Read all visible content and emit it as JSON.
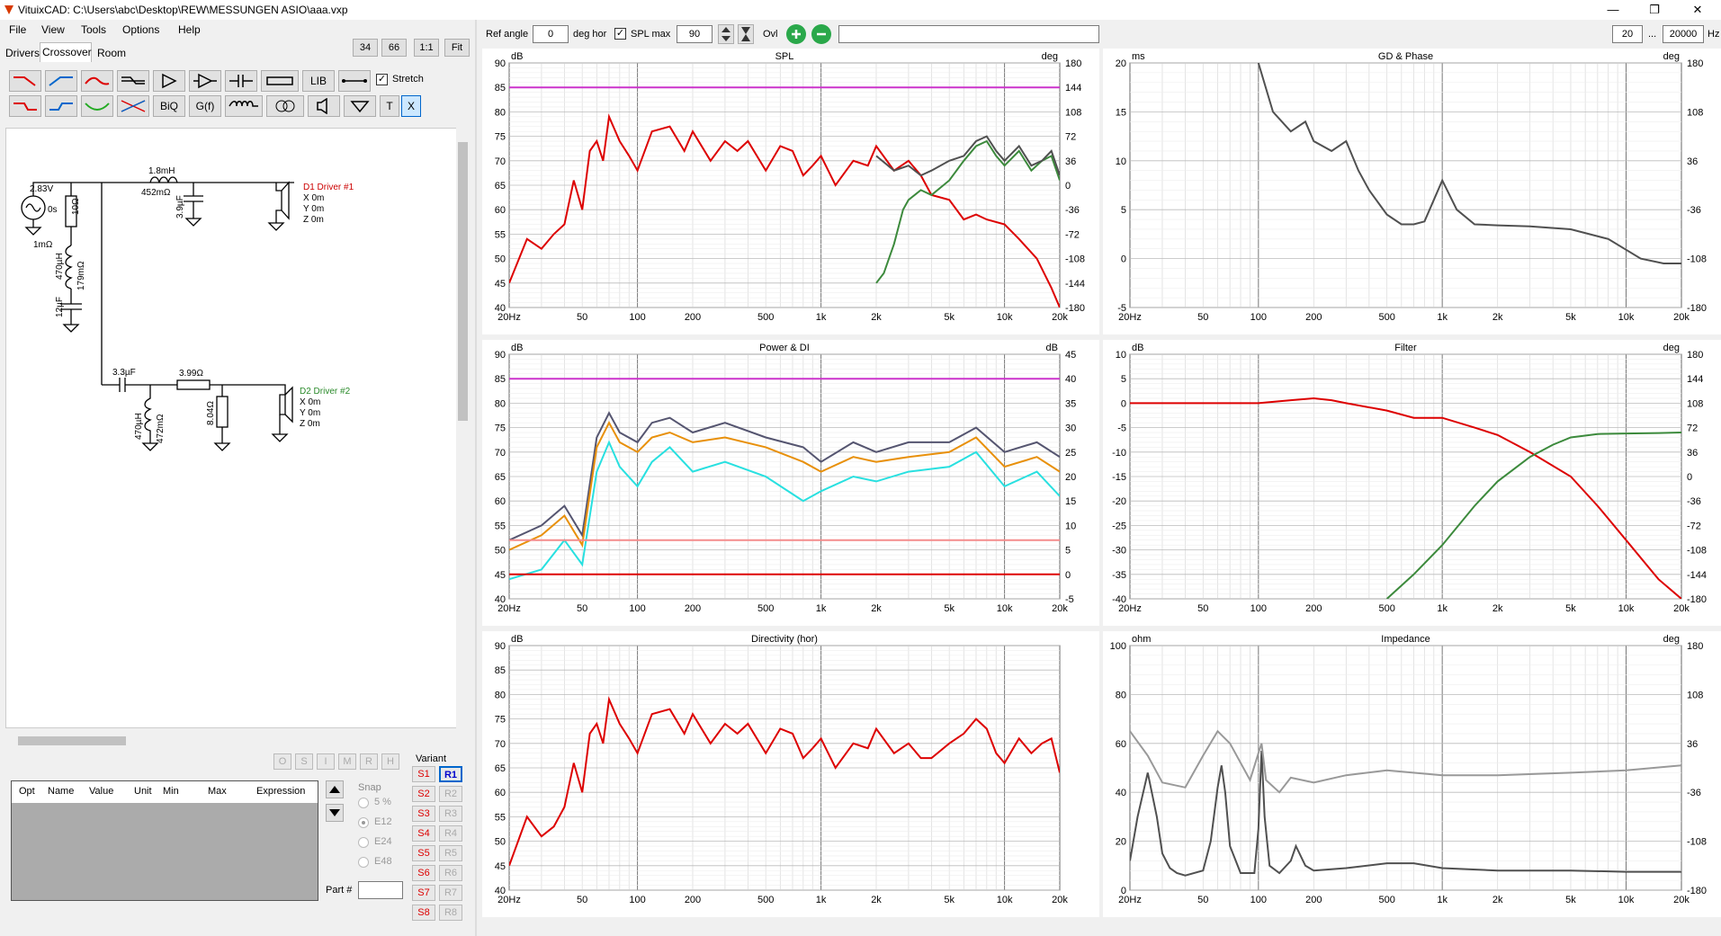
{
  "title": "VituixCAD: C:\\Users\\abc\\Desktop\\REW\\MESSUNGEN ASIO\\aaa.vxp",
  "menu": [
    "File",
    "View",
    "Tools",
    "Options",
    "Help"
  ],
  "tabs": [
    "Drivers",
    "Crossover",
    "Room"
  ],
  "zoom_buttons": [
    "34",
    "66",
    "1:1",
    "Fit"
  ],
  "toolbar": {
    "lib": "LIB",
    "stretch": "Stretch",
    "biq": "BiQ",
    "gf": "G(f)",
    "t": "T",
    "x": "X"
  },
  "top_controls": {
    "ref_angle_label": "Ref angle",
    "ref_angle_value": "0",
    "deg_hor": "deg hor",
    "splmax_label": "SPL max",
    "splmax_value": "90",
    "ovl": "Ovl",
    "freq_from": "20",
    "freq_sep": "...",
    "freq_to": "20000",
    "freq_unit": "Hz"
  },
  "schematic": {
    "source_v": "2.83V",
    "source_ang": "0s",
    "source_r": "1mΩ",
    "r1": "10Ω",
    "l_series": "1.8mH",
    "l_series_r": "452mΩ",
    "c_shunt": "3.9µF",
    "d1_name": "D1 Driver #1",
    "d1_x": "X 0m",
    "d1_y": "Y 0m",
    "d1_z": "Z 0m",
    "l_notch": "470µH",
    "l_notch_r": "179mΩ",
    "c_notch": "12µF",
    "c2": "3.3µF",
    "r2": "3.99Ω",
    "l2": "470µH",
    "l2_r": "472mΩ",
    "r3": "8.04Ω",
    "d2_name": "D2 Driver #2",
    "d2_x": "X 0m",
    "d2_y": "Y 0m",
    "d2_z": "Z 0m"
  },
  "param_table": {
    "headers": [
      "Opt",
      "Name",
      "Value",
      "Unit",
      "Min",
      "Max",
      "Expression"
    ]
  },
  "oslmrh": [
    "O",
    "S",
    "I",
    "M",
    "R",
    "H"
  ],
  "snap": {
    "label": "Snap",
    "options": [
      "5 %",
      "E12",
      "E24",
      "E48"
    ],
    "selected": "E12"
  },
  "part_label": "Part #",
  "variant": {
    "label": "Variant",
    "s": [
      "S1",
      "S2",
      "S3",
      "S4",
      "S5",
      "S6",
      "S7",
      "S8"
    ],
    "r": [
      "R1",
      "R2",
      "R3",
      "R4",
      "R5",
      "R6",
      "R7",
      "R8"
    ]
  },
  "colors": {
    "red": "#dd0000",
    "green": "#3c8a3c",
    "darkgrey": "#505050",
    "orange": "#e8900a",
    "cyan": "#28e0e0",
    "navy": "#555570",
    "magenta": "#cc33cc",
    "pink": "#f48c8c"
  },
  "chart_data": [
    {
      "type": "line",
      "title": "SPL",
      "ylabel": "dB",
      "y2label": "deg",
      "ylim": [
        40,
        90
      ],
      "y2lim": [
        -180,
        180
      ],
      "xscale": "log",
      "xlim": [
        20,
        20000
      ],
      "yticks": [
        "90",
        "85",
        "80",
        "75",
        "70",
        "65",
        "60",
        "55",
        "50",
        "45",
        "40"
      ],
      "y2ticks": [
        "180",
        "144",
        "108",
        "72",
        "36",
        "0",
        "-36",
        "-72",
        "-108",
        "-144",
        "-180"
      ],
      "xticks": [
        "20Hz",
        "50",
        "100",
        "200",
        "500",
        "1k",
        "2k",
        "5k",
        "10k",
        "20k"
      ],
      "series": [
        {
          "color": "#dd0000",
          "x": [
            20,
            25,
            30,
            35,
            40,
            45,
            50,
            55,
            60,
            65,
            70,
            80,
            90,
            100,
            120,
            150,
            180,
            200,
            250,
            300,
            350,
            400,
            500,
            600,
            700,
            800,
            900,
            1000,
            1200,
            1500,
            1800,
            2000,
            2500,
            3000,
            3500,
            4000,
            5000,
            6000,
            7000,
            8000,
            10000,
            12000,
            15000,
            18000,
            20000
          ],
          "y": [
            45,
            54,
            52,
            55,
            57,
            66,
            60,
            72,
            74,
            70,
            79,
            74,
            71,
            68,
            76,
            77,
            72,
            76,
            70,
            74,
            72,
            74,
            68,
            73,
            72,
            67,
            69,
            71,
            65,
            70,
            69,
            73,
            68,
            70,
            67,
            63,
            62,
            58,
            59,
            58,
            57,
            54,
            50,
            44,
            40
          ]
        },
        {
          "color": "#3c8a3c",
          "x": [
            2000,
            2200,
            2500,
            2800,
            3000,
            3500,
            4000,
            5000,
            6000,
            7000,
            8000,
            9000,
            10000,
            12000,
            14000,
            16000,
            18000,
            20000
          ],
          "y": [
            45,
            47,
            53,
            60,
            62,
            64,
            63,
            66,
            70,
            73,
            74,
            71,
            69,
            72,
            68,
            70,
            71,
            66
          ]
        },
        {
          "color": "#505050",
          "x": [
            2000,
            2500,
            3000,
            3500,
            4000,
            5000,
            6000,
            7000,
            8000,
            9000,
            10000,
            12000,
            14000,
            16000,
            18000,
            20000
          ],
          "y": [
            71,
            68,
            69,
            67,
            68,
            70,
            71,
            74,
            75,
            72,
            70,
            73,
            69,
            70,
            72,
            67
          ]
        },
        {
          "color": "#cc33cc",
          "x": [
            20,
            20000
          ],
          "y": [
            85,
            85
          ]
        }
      ]
    },
    {
      "type": "line",
      "title": "GD & Phase",
      "ylabel": "ms",
      "y2label": "deg",
      "ylim": [
        -5,
        20
      ],
      "y2lim": [
        -180,
        180
      ],
      "xscale": "log",
      "xlim": [
        20,
        20000
      ],
      "yticks": [
        "20",
        "15",
        "10",
        "5",
        "0",
        "-5"
      ],
      "y2ticks": [
        "180",
        "108",
        "36",
        "-36",
        "-108",
        "-180"
      ],
      "xticks": [
        "20Hz",
        "50",
        "100",
        "200",
        "500",
        "1k",
        "2k",
        "5k",
        "10k",
        "20k"
      ],
      "series": [
        {
          "color": "#505050",
          "x": [
            100,
            120,
            150,
            180,
            200,
            250,
            300,
            350,
            400,
            500,
            600,
            700,
            800,
            900,
            1000,
            1200,
            1500,
            2000,
            3000,
            5000,
            8000,
            12000,
            16000,
            20000
          ],
          "y": [
            20,
            15,
            13,
            14,
            12,
            11,
            12,
            9,
            7,
            4.5,
            3.5,
            3.5,
            3.8,
            6,
            8,
            5,
            3.5,
            3.4,
            3.3,
            3,
            2,
            0,
            -0.5,
            -0.5
          ]
        }
      ]
    },
    {
      "type": "line",
      "title": "Power & DI",
      "ylabel": "dB",
      "y2label": "dB",
      "ylim": [
        40,
        90
      ],
      "y2lim": [
        -5,
        45
      ],
      "xscale": "log",
      "xlim": [
        20,
        20000
      ],
      "yticks": [
        "90",
        "85",
        "80",
        "75",
        "70",
        "65",
        "60",
        "55",
        "50",
        "45",
        "40"
      ],
      "y2ticks": [
        "45",
        "40",
        "35",
        "30",
        "25",
        "20",
        "15",
        "10",
        "5",
        "0",
        "-5"
      ],
      "xticks": [
        "20Hz",
        "50",
        "100",
        "200",
        "500",
        "1k",
        "2k",
        "5k",
        "10k",
        "20k"
      ],
      "series": [
        {
          "color": "#555570",
          "x": [
            20,
            30,
            40,
            50,
            60,
            70,
            80,
            100,
            120,
            150,
            200,
            300,
            500,
            800,
            1000,
            1500,
            2000,
            3000,
            5000,
            7000,
            10000,
            15000,
            20000
          ],
          "y": [
            52,
            55,
            59,
            53,
            73,
            78,
            74,
            72,
            76,
            77,
            74,
            76,
            73,
            71,
            68,
            72,
            70,
            72,
            72,
            75,
            70,
            72,
            69
          ]
        },
        {
          "color": "#e8900a",
          "x": [
            20,
            30,
            40,
            50,
            60,
            70,
            80,
            100,
            120,
            150,
            200,
            300,
            500,
            800,
            1000,
            1500,
            2000,
            3000,
            5000,
            7000,
            10000,
            15000,
            20000
          ],
          "y": [
            50,
            53,
            57,
            51,
            71,
            76,
            72,
            70,
            73,
            74,
            72,
            73,
            71,
            68,
            66,
            69,
            68,
            69,
            70,
            73,
            67,
            69,
            66
          ]
        },
        {
          "color": "#28e0e0",
          "x": [
            20,
            30,
            40,
            50,
            60,
            70,
            80,
            100,
            120,
            150,
            200,
            300,
            500,
            800,
            1000,
            1500,
            2000,
            3000,
            5000,
            7000,
            10000,
            15000,
            20000
          ],
          "y": [
            44,
            46,
            52,
            47,
            66,
            72,
            67,
            63,
            68,
            71,
            66,
            68,
            65,
            60,
            62,
            65,
            64,
            66,
            67,
            70,
            63,
            66,
            61
          ]
        },
        {
          "color": "#f48c8c",
          "x": [
            20,
            20000
          ],
          "y": [
            52,
            52
          ]
        },
        {
          "color": "#dd0000",
          "x": [
            20,
            20000
          ],
          "y": [
            45,
            45
          ]
        },
        {
          "color": "#cc33cc",
          "x": [
            20,
            20000
          ],
          "y": [
            85,
            85
          ]
        }
      ]
    },
    {
      "type": "line",
      "title": "Filter",
      "ylabel": "dB",
      "y2label": "deg",
      "ylim": [
        -40,
        10
      ],
      "y2lim": [
        -180,
        180
      ],
      "xscale": "log",
      "xlim": [
        20,
        20000
      ],
      "yticks": [
        "10",
        "5",
        "0",
        "-5",
        "-10",
        "-15",
        "-20",
        "-25",
        "-30",
        "-35",
        "-40"
      ],
      "y2ticks": [
        "180",
        "144",
        "108",
        "72",
        "36",
        "0",
        "-36",
        "-72",
        "-108",
        "-144",
        "-180"
      ],
      "xticks": [
        "20Hz",
        "50",
        "100",
        "200",
        "500",
        "1k",
        "2k",
        "5k",
        "10k",
        "20k"
      ],
      "series": [
        {
          "color": "#dd0000",
          "x": [
            20,
            50,
            100,
            150,
            200,
            250,
            300,
            500,
            700,
            1000,
            1500,
            2000,
            3000,
            5000,
            7000,
            10000,
            15000,
            20000
          ],
          "y": [
            0,
            0,
            0,
            0.6,
            1,
            0.6,
            0,
            -1.5,
            -3,
            -3,
            -5,
            -6.5,
            -10,
            -15,
            -21,
            -28,
            -36,
            -40
          ]
        },
        {
          "color": "#3c8a3c",
          "x": [
            500,
            700,
            1000,
            1500,
            2000,
            3000,
            4000,
            5000,
            7000,
            10000,
            15000,
            20000
          ],
          "y": [
            -40,
            -35,
            -29,
            -21,
            -16,
            -11,
            -8.5,
            -7,
            -6.3,
            -6.2,
            -6.1,
            -6
          ]
        }
      ]
    },
    {
      "type": "line",
      "title": "Directivity (hor)",
      "ylabel": "dB",
      "ylim": [
        40,
        90
      ],
      "xscale": "log",
      "xlim": [
        20,
        20000
      ],
      "yticks": [
        "90",
        "85",
        "80",
        "75",
        "70",
        "65",
        "60",
        "55",
        "50",
        "45",
        "40"
      ],
      "xticks": [
        "20Hz",
        "50",
        "100",
        "200",
        "500",
        "1k",
        "2k",
        "5k",
        "10k",
        "20k"
      ],
      "series": [
        {
          "color": "#dd0000",
          "x": [
            20,
            25,
            30,
            35,
            40,
            45,
            50,
            55,
            60,
            65,
            70,
            80,
            90,
            100,
            120,
            150,
            180,
            200,
            250,
            300,
            350,
            400,
            500,
            600,
            700,
            800,
            900,
            1000,
            1200,
            1500,
            1800,
            2000,
            2500,
            3000,
            3500,
            4000,
            5000,
            6000,
            7000,
            8000,
            9000,
            10000,
            12000,
            14000,
            16000,
            18000,
            20000
          ],
          "y": [
            45,
            55,
            51,
            53,
            57,
            66,
            60,
            72,
            74,
            70,
            79,
            74,
            71,
            68,
            76,
            77,
            72,
            76,
            70,
            74,
            72,
            74,
            68,
            73,
            72,
            67,
            69,
            71,
            65,
            70,
            69,
            73,
            68,
            70,
            67,
            67,
            70,
            72,
            75,
            73,
            68,
            66,
            71,
            68,
            70,
            71,
            64
          ]
        }
      ]
    },
    {
      "type": "line",
      "title": "Impedance",
      "ylabel": "ohm",
      "y2label": "deg",
      "ylim": [
        0,
        100
      ],
      "y2lim": [
        -180,
        180
      ],
      "xscale": "log",
      "xlim": [
        20,
        20000
      ],
      "yticks": [
        "100",
        "80",
        "60",
        "40",
        "20",
        "0"
      ],
      "y2ticks": [
        "180",
        "108",
        "36",
        "-36",
        "-108",
        "-180"
      ],
      "xticks": [
        "20Hz",
        "50",
        "100",
        "200",
        "500",
        "1k",
        "2k",
        "5k",
        "10k",
        "20k"
      ],
      "series": [
        {
          "color": "#505050",
          "x": [
            20,
            22,
            25,
            28,
            30,
            33,
            36,
            40,
            50,
            55,
            60,
            63,
            66,
            70,
            80,
            95,
            100,
            104,
            108,
            115,
            130,
            150,
            160,
            180,
            200,
            300,
            500,
            700,
            1000,
            2000,
            5000,
            10000,
            20000
          ],
          "y": [
            12,
            30,
            48,
            30,
            15,
            9,
            7,
            6,
            8,
            20,
            42,
            51,
            40,
            18,
            7,
            7,
            25,
            57,
            30,
            10,
            7,
            12,
            18,
            10,
            8,
            9,
            11,
            11,
            9,
            8,
            8,
            7.5,
            7.5
          ]
        },
        {
          "color": "#999999",
          "x": [
            20,
            25,
            30,
            40,
            50,
            60,
            70,
            90,
            100,
            104,
            110,
            130,
            150,
            200,
            300,
            500,
            1000,
            2000,
            5000,
            10000,
            20000
          ],
          "y": [
            65,
            55,
            44,
            42,
            55,
            65,
            60,
            45,
            56,
            60,
            45,
            40,
            46,
            44,
            47,
            49,
            47,
            47,
            48,
            49,
            51
          ]
        }
      ]
    }
  ]
}
